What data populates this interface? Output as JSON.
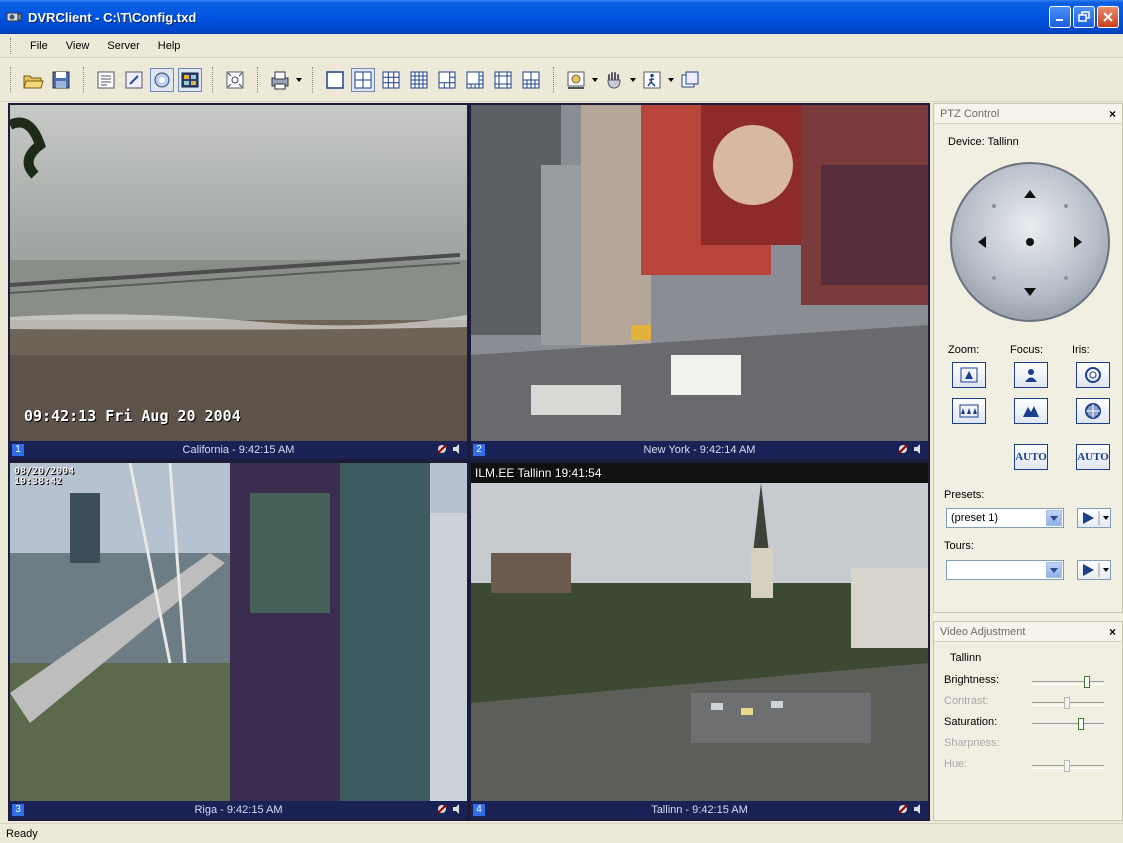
{
  "window": {
    "title": "DVRClient - C:\\T\\Config.txd"
  },
  "menu": [
    "File",
    "View",
    "Server",
    "Help"
  ],
  "toolbar": {
    "icons": [
      "open-icon",
      "save-icon",
      "list-icon",
      "edit-icon",
      "view-circle-icon",
      "grid-view-icon",
      "fullscreen-icon",
      "print-icon",
      "layout-1-icon",
      "layout-4-icon",
      "layout-9-icon",
      "layout-16-icon",
      "layout-6-icon",
      "layout-8-icon",
      "layout-13-icon",
      "layout-10-icon",
      "snapshot-icon",
      "hand-icon",
      "motion-icon",
      "window-icon"
    ]
  },
  "cameras": [
    {
      "num": "1",
      "caption": "California - 9:42:15 AM",
      "overlay": "09:42:13 Fri Aug 20 2004"
    },
    {
      "num": "2",
      "caption": "New York - 9:42:14 AM",
      "overlay": ""
    },
    {
      "num": "3",
      "caption": "Riga - 9:42:15 AM",
      "overlay": "08/20/2004\n19:38:42"
    },
    {
      "num": "4",
      "caption": "Tallinn - 9:42:15 AM",
      "overlay": "ILM.EE Tallinn 19:41:54"
    }
  ],
  "ptz": {
    "title": "PTZ Control",
    "close": "×",
    "device": "Device: Tallinn",
    "zoom_label": "Zoom:",
    "focus_label": "Focus:",
    "iris_label": "Iris:",
    "auto1": "AUTO",
    "auto2": "AUTO",
    "presets_label": "Presets:",
    "preset_value": "(preset 1)",
    "tours_label": "Tours:",
    "tour_value": ""
  },
  "video_adjust": {
    "title": "Video Adjustment",
    "close": "×",
    "device": "Tallinn",
    "rows": [
      {
        "label": "Brightness:",
        "enabled": true,
        "level": 0.82
      },
      {
        "label": "Contrast:",
        "enabled": false,
        "level": 0.5
      },
      {
        "label": "Saturation:",
        "enabled": true,
        "level": 0.72
      },
      {
        "label": "Sharpness:",
        "enabled": false,
        "level": null
      },
      {
        "label": "Hue:",
        "enabled": false,
        "level": 0.5
      }
    ]
  },
  "status": "Ready"
}
